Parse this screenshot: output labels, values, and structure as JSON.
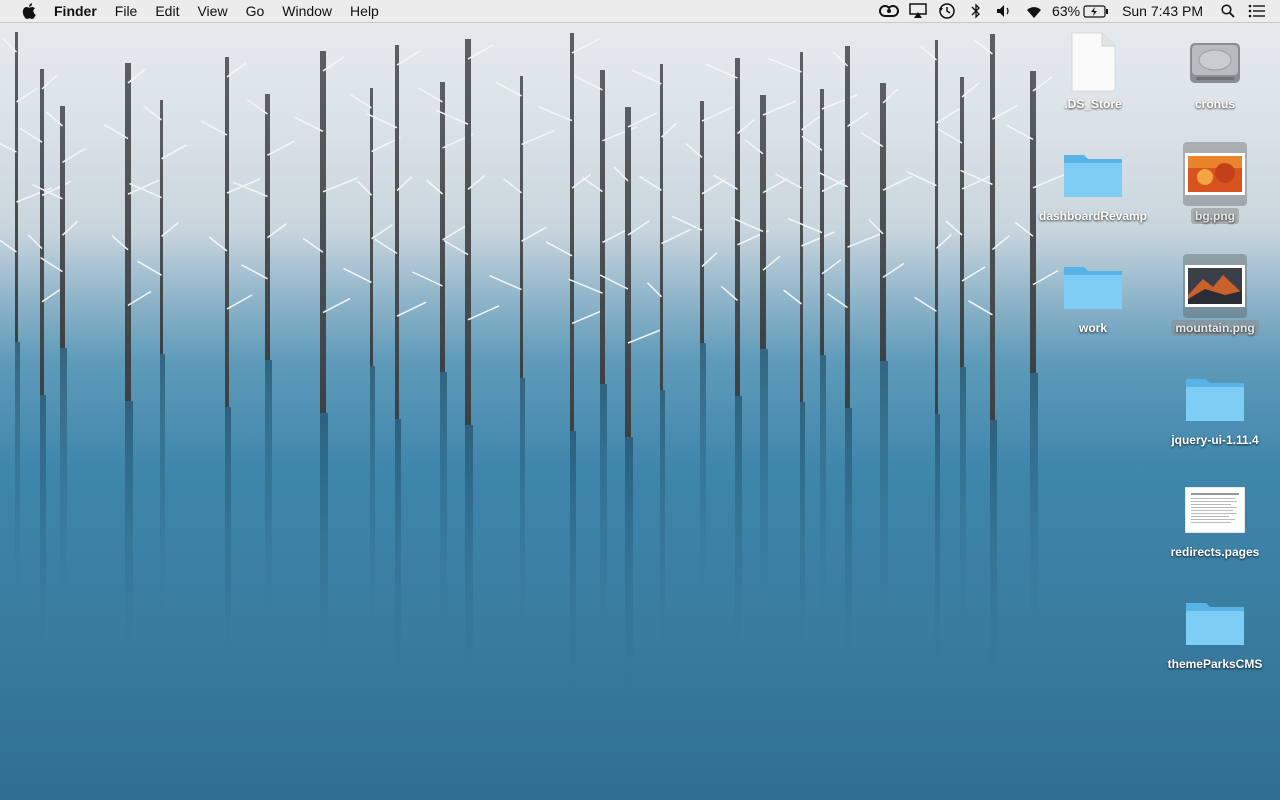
{
  "menubar": {
    "app_name": "Finder",
    "menus": [
      "File",
      "Edit",
      "View",
      "Go",
      "Window",
      "Help"
    ],
    "status_icons": [
      "creative-cloud-icon",
      "airplay-icon",
      "time-machine-icon",
      "bluetooth-icon",
      "volume-icon",
      "wifi-icon"
    ],
    "battery_percent": "63%",
    "clock": "Sun 7:43 PM"
  },
  "desktop": {
    "items": [
      {
        "name": ".DS_Store",
        "icon": "document-icon",
        "selected": false
      },
      {
        "name": "cronus",
        "icon": "hard-drive-icon",
        "selected": false
      },
      {
        "name": "dashboardRevamp",
        "icon": "folder-icon",
        "selected": false
      },
      {
        "name": "bg.png",
        "icon": "image-thumbnail-icon",
        "selected": true
      },
      {
        "name": "work",
        "icon": "folder-icon",
        "selected": false
      },
      {
        "name": "mountain.png",
        "icon": "image-thumbnail-icon",
        "selected": true
      },
      {
        "name": "jquery-ui-1.11.4",
        "icon": "folder-icon",
        "selected": false
      },
      {
        "name": "redirects.pages",
        "icon": "pages-document-icon",
        "selected": false
      },
      {
        "name": "themeParksCMS",
        "icon": "folder-icon",
        "selected": false
      }
    ]
  },
  "colors": {
    "folder": "#6cc3ef",
    "menubar": "#ececec"
  }
}
